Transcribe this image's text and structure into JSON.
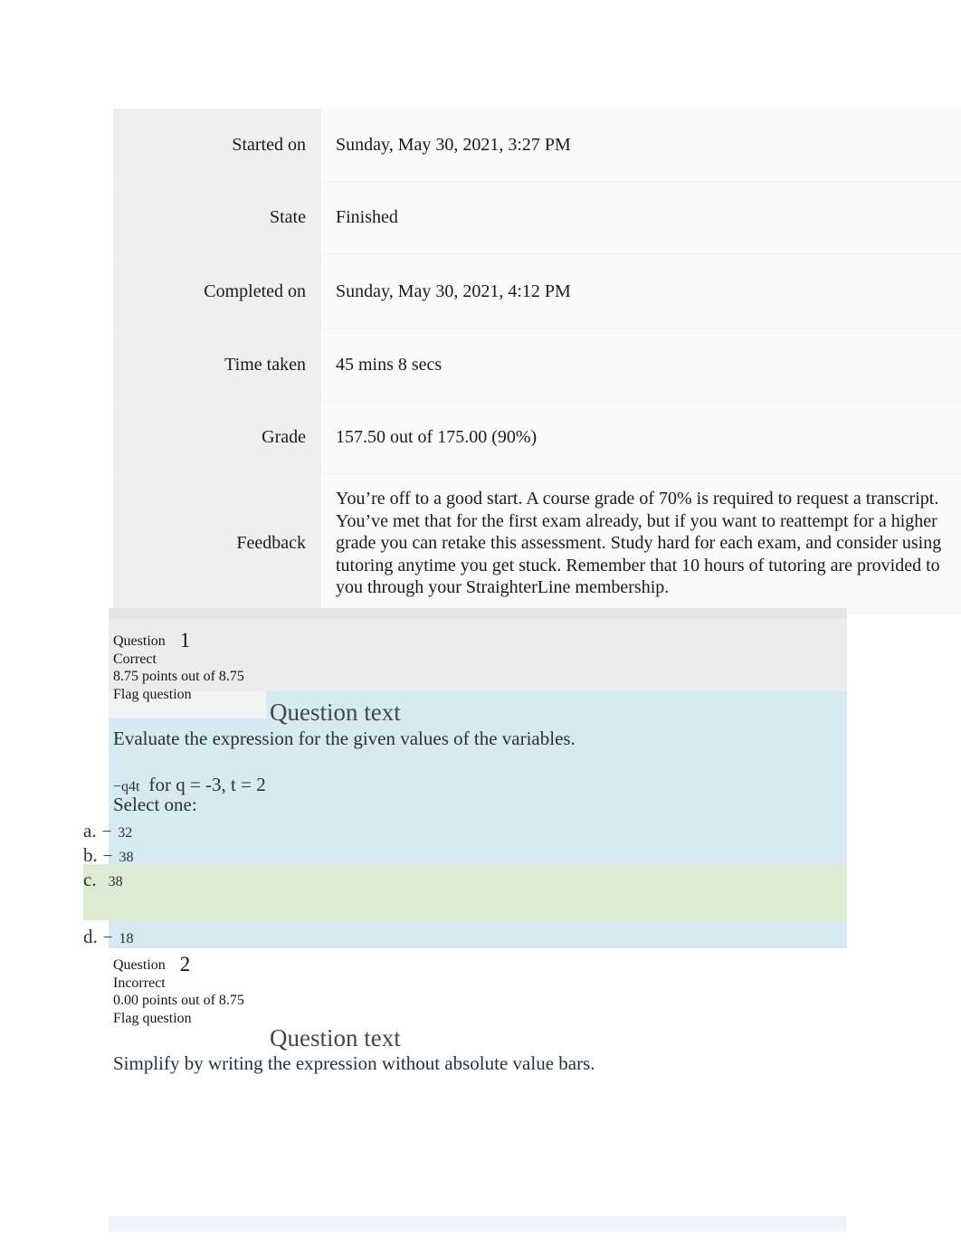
{
  "summary": {
    "rows": [
      {
        "label": "Started on",
        "value": "Sunday, May 30, 2021, 3:27 PM"
      },
      {
        "label": "State",
        "value": "Finished"
      },
      {
        "label": "Completed on",
        "value": "Sunday, May 30, 2021, 4:12 PM"
      },
      {
        "label": "Time taken",
        "value": "45 mins 8 secs"
      },
      {
        "label": "Grade",
        "value": "157.50 out of 175.00 (90%)"
      },
      {
        "label": "Feedback",
        "value": "You’re off to a good start. A course grade of 70% is required to request a transcript. You’ve met that for the first exam already, but if you want to reattempt for a higher grade you can retake this assessment. Study hard for each exam, and consider using tutoring anytime you get stuck. Remember that 10 hours of tutoring are provided to you through your StraighterLine membership."
      }
    ]
  },
  "questions": [
    {
      "number_label": "Question",
      "number": "1",
      "state": "Correct",
      "marks": "8.75 points out of 8.75",
      "flag": "Flag question",
      "text_heading": "Question text",
      "stem": "Evaluate the expression for the given values of the variables.",
      "expression_main": "−q4t",
      "expression_rest": "for  q = -3, t = 2",
      "select_one": "Select one:",
      "options": [
        {
          "letter": "a.",
          "minus": "−",
          "value": "32",
          "selected": false
        },
        {
          "letter": "b.",
          "minus": "−",
          "value": "38",
          "selected": false
        },
        {
          "letter": "c.",
          "minus": "",
          "value": "38",
          "selected": true
        },
        {
          "letter": "d.",
          "minus": "−",
          "value": "18",
          "selected": false
        }
      ]
    },
    {
      "number_label": "Question",
      "number": "2",
      "state": "Incorrect",
      "marks": "0.00 points out of 8.75",
      "flag": "Flag question",
      "text_heading": "Question text",
      "stem": "Simplify by writing the expression without absolute value bars."
    }
  ],
  "colors": {
    "label_cell_bg": "#efeff0",
    "value_cell_bg": "#fafafa",
    "question_header_bg": "#ececec",
    "question_body_tint": "#d7e9f1",
    "correct_answer_tint": "#dcecd3",
    "heading_text": "#3f4a4f"
  }
}
